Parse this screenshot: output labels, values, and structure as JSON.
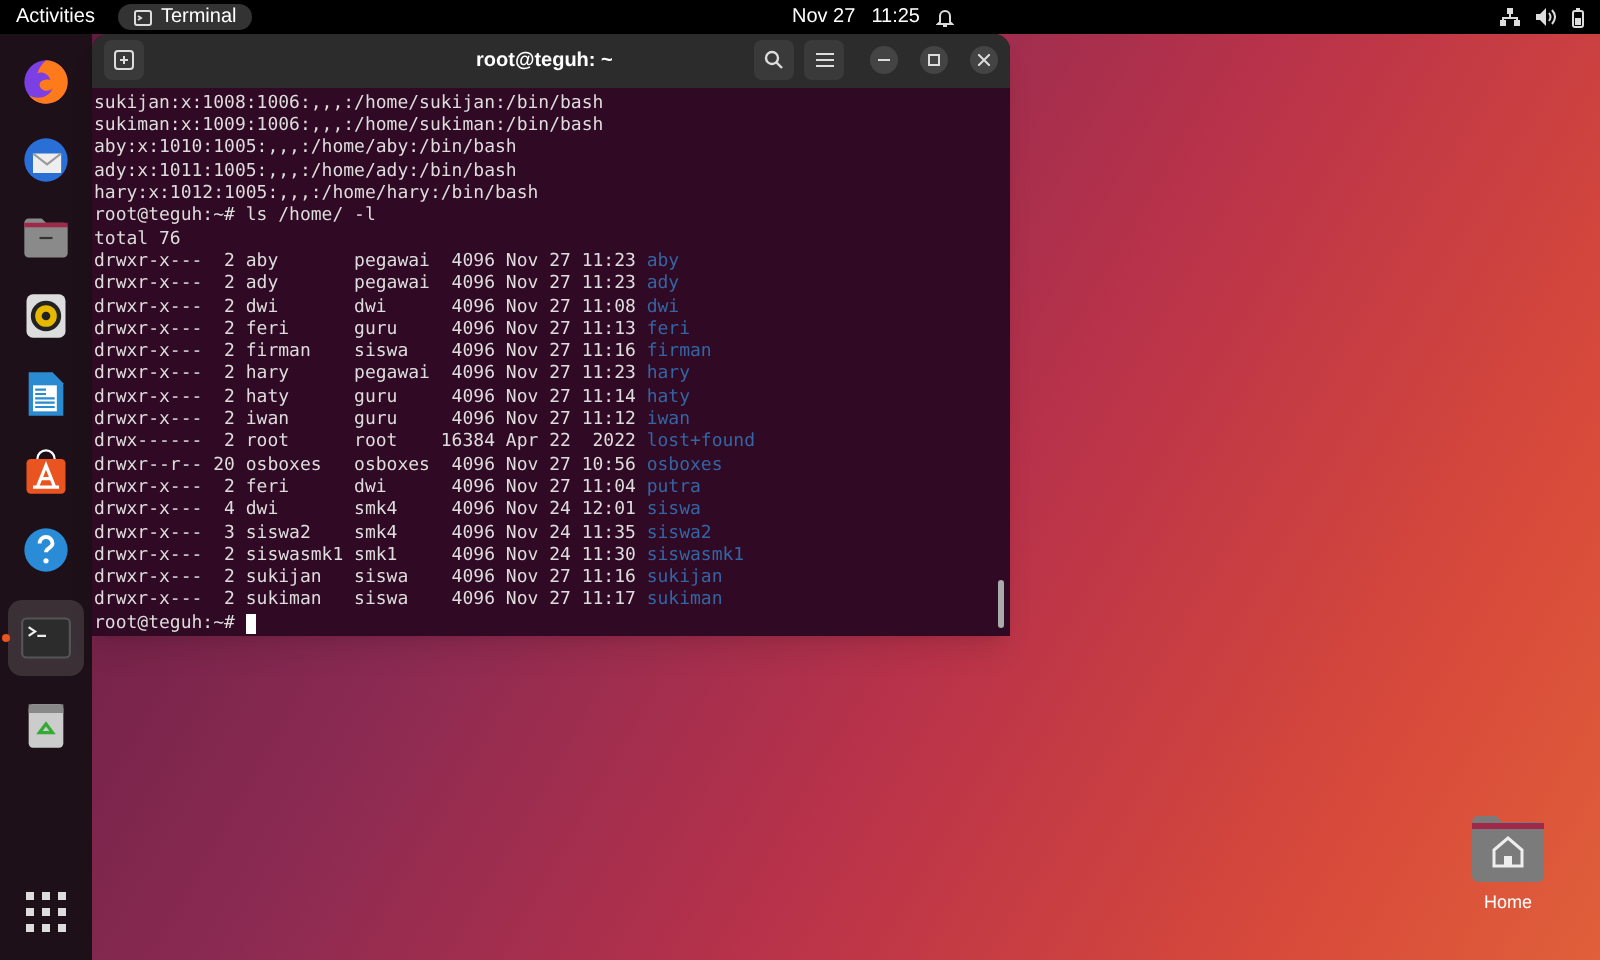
{
  "top_bar": {
    "activities": "Activities",
    "app": "Terminal",
    "date": "Nov 27",
    "time": "11:25"
  },
  "dock": [
    {
      "kind": "firefox",
      "selected": false
    },
    {
      "kind": "mail",
      "selected": false
    },
    {
      "kind": "files",
      "selected": false
    },
    {
      "kind": "music",
      "selected": false
    },
    {
      "kind": "writer",
      "selected": false
    },
    {
      "kind": "store",
      "selected": false
    },
    {
      "kind": "help",
      "selected": false
    },
    {
      "kind": "terminal",
      "selected": true
    },
    {
      "kind": "trash",
      "selected": false
    }
  ],
  "terminal": {
    "title": "root@teguh: ~",
    "lines": [
      {
        "kind": "text",
        "text": "sukijan:x:1008:1006:,,,:/home/sukijan:/bin/bash"
      },
      {
        "kind": "text",
        "text": "sukiman:x:1009:1006:,,,:/home/sukiman:/bin/bash"
      },
      {
        "kind": "text",
        "text": "aby:x:1010:1005:,,,:/home/aby:/bin/bash"
      },
      {
        "kind": "text",
        "text": "ady:x:1011:1005:,,,:/home/ady:/bin/bash"
      },
      {
        "kind": "text",
        "text": "hary:x:1012:1005:,,,:/home/hary:/bin/bash"
      },
      {
        "kind": "text",
        "text": "root@teguh:~# ls /home/ -l"
      },
      {
        "kind": "text",
        "text": "total 76"
      },
      {
        "kind": "listing",
        "info": "drwxr-x---  2 aby       pegawai  4096 Nov 27 11:23",
        "name": "aby"
      },
      {
        "kind": "listing",
        "info": "drwxr-x---  2 ady       pegawai  4096 Nov 27 11:23",
        "name": "ady"
      },
      {
        "kind": "listing",
        "info": "drwxr-x---  2 dwi       dwi      4096 Nov 27 11:08",
        "name": "dwi"
      },
      {
        "kind": "listing",
        "info": "drwxr-x---  2 feri      guru     4096 Nov 27 11:13",
        "name": "feri"
      },
      {
        "kind": "listing",
        "info": "drwxr-x---  2 firman    siswa    4096 Nov 27 11:16",
        "name": "firman"
      },
      {
        "kind": "listing",
        "info": "drwxr-x---  2 hary      pegawai  4096 Nov 27 11:23",
        "name": "hary"
      },
      {
        "kind": "listing",
        "info": "drwxr-x---  2 haty      guru     4096 Nov 27 11:14",
        "name": "haty"
      },
      {
        "kind": "listing",
        "info": "drwxr-x---  2 iwan      guru     4096 Nov 27 11:12",
        "name": "iwan"
      },
      {
        "kind": "listing",
        "info": "drwx------  2 root      root    16384 Apr 22  2022",
        "name": "lost+found"
      },
      {
        "kind": "listing",
        "info": "drwxr--r-- 20 osboxes   osboxes  4096 Nov 27 10:56",
        "name": "osboxes"
      },
      {
        "kind": "listing",
        "info": "drwxr-x---  2 feri      dwi      4096 Nov 27 11:04",
        "name": "putra"
      },
      {
        "kind": "listing",
        "info": "drwxr-x---  4 dwi       smk4     4096 Nov 24 12:01",
        "name": "siswa"
      },
      {
        "kind": "listing",
        "info": "drwxr-x---  3 siswa2    smk4     4096 Nov 24 11:35",
        "name": "siswa2"
      },
      {
        "kind": "listing",
        "info": "drwxr-x---  2 siswasmk1 smk1     4096 Nov 24 11:30",
        "name": "siswasmk1"
      },
      {
        "kind": "listing",
        "info": "drwxr-x---  2 sukijan   siswa    4096 Nov 27 11:16",
        "name": "sukijan"
      },
      {
        "kind": "listing",
        "info": "drwxr-x---  2 sukiman   siswa    4096 Nov 27 11:17",
        "name": "sukiman"
      },
      {
        "kind": "prompt",
        "text": "root@teguh:~#"
      }
    ]
  },
  "desktop": {
    "home_label": "Home"
  }
}
